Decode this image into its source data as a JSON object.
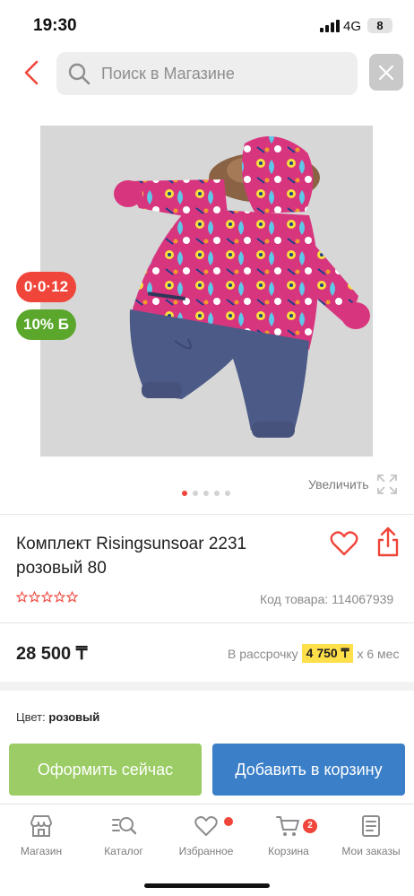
{
  "status_bar": {
    "time": "19:30",
    "network": "4G",
    "battery": "8"
  },
  "header": {
    "search_placeholder": "Поиск в Магазине"
  },
  "product": {
    "badges": {
      "installment": "0·0·12",
      "bonus": "10% Б"
    },
    "zoom_label": "Увеличить",
    "gallery_pages": 5,
    "gallery_active_page": 1,
    "title": "Комплект Risingsunsoar 2231 розовый 80",
    "rating_stars": 0,
    "rating_max": 5,
    "sku": "Код товара: 114067939",
    "price": "28 500 ₸",
    "installment": {
      "prefix": "В рассрочку",
      "amount": "4 750 ₸",
      "suffix": "х 6 мес"
    },
    "color": {
      "label": "Цвет:",
      "value": "розовый"
    }
  },
  "actions": {
    "buy_now": "Оформить сейчас",
    "add_to_cart": "Добавить в корзину"
  },
  "tabbar": {
    "items": [
      {
        "label": "Магазин",
        "icon": "shop-icon"
      },
      {
        "label": "Каталог",
        "icon": "catalog-search-icon"
      },
      {
        "label": "Избранное",
        "icon": "heart-icon"
      },
      {
        "label": "Корзина",
        "icon": "cart-icon",
        "badge": "2"
      },
      {
        "label": "Мои заказы",
        "icon": "orders-icon"
      }
    ]
  },
  "colors": {
    "accent_red": "#f0453a",
    "buy_green": "#9bcc65",
    "cart_blue": "#3a7fc8",
    "installment_yellow": "#ffe04a",
    "bonus_green": "#5aa72b"
  }
}
